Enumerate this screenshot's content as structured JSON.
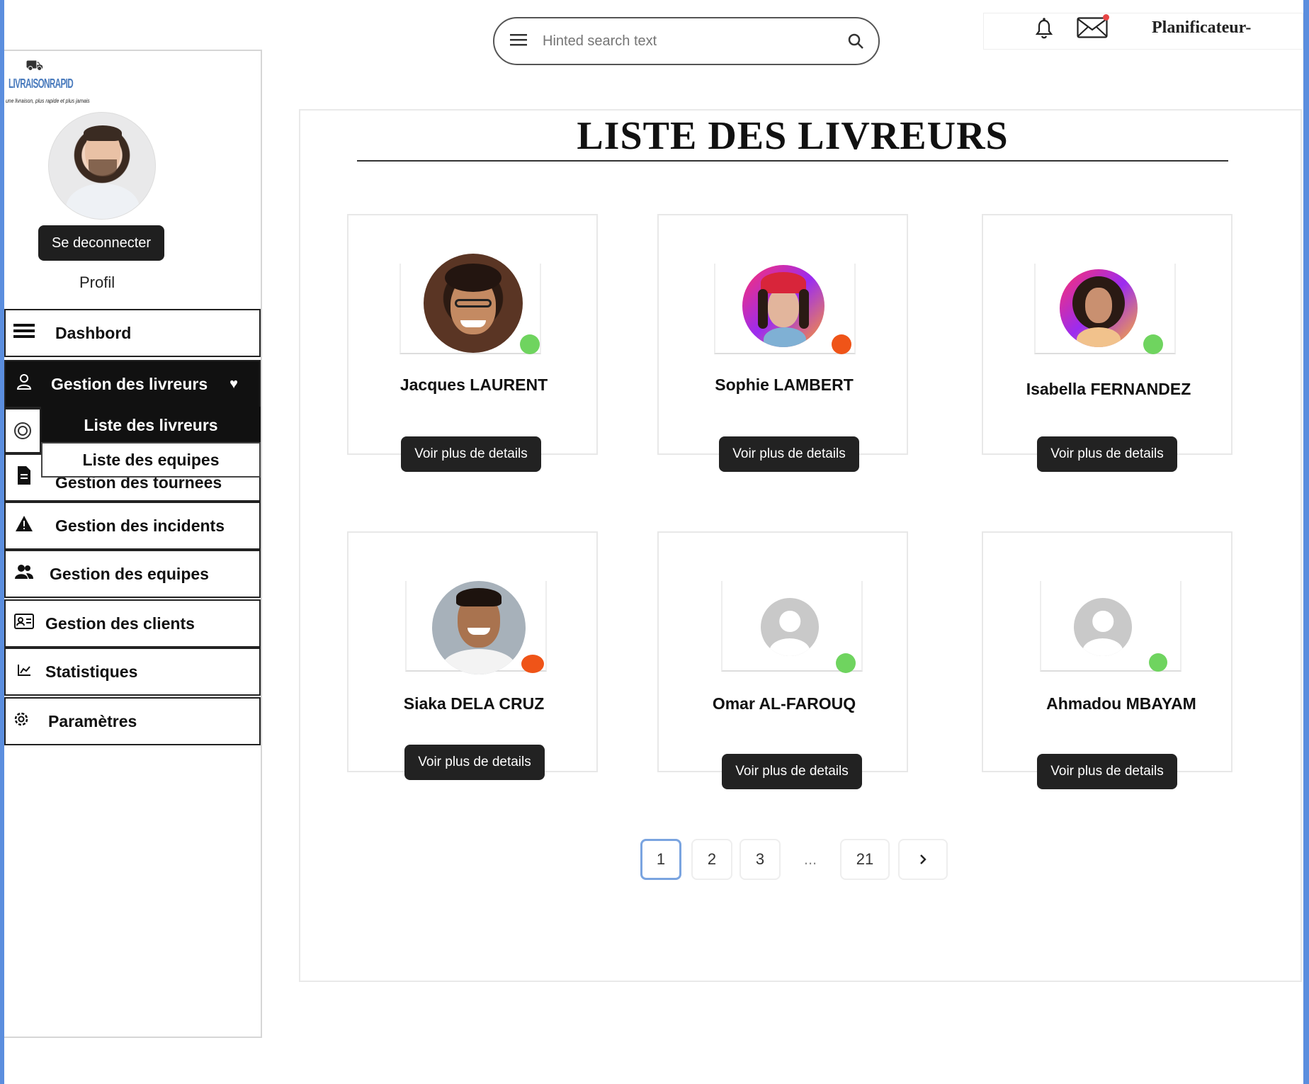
{
  "app": {
    "logo_text": "LIVRAISONRAPID",
    "logo_tagline": "une livraison, plus rapide et plus jamais"
  },
  "sidebar": {
    "logout_label": "Se deconnecter",
    "profile_label": "Profil",
    "items": [
      {
        "label": "Dashbord",
        "icon": "menu-icon"
      },
      {
        "label": "Gestion des livreurs",
        "icon": "user-icon",
        "active": true
      },
      {
        "label": "Gestion des tournees",
        "icon": "document-icon"
      },
      {
        "label": "Gestion des incidents",
        "icon": "warning-icon"
      },
      {
        "label": "Gestion des equipes",
        "icon": "team-icon"
      },
      {
        "label": "Gestion des clients",
        "icon": "id-card-icon"
      },
      {
        "label": "Statistiques",
        "icon": "chart-icon"
      },
      {
        "label": "Paramètres",
        "icon": "gear-icon"
      }
    ],
    "submenu": [
      {
        "label": "Liste des livreurs",
        "active": true
      },
      {
        "label": "Liste des equipes"
      }
    ]
  },
  "header": {
    "search_placeholder": "Hinted search text",
    "user_role": "Planificateur-"
  },
  "main": {
    "title": "LISTE DES  LIVREURS",
    "details_label": "Voir plus de details",
    "couriers": [
      {
        "name": "Jacques LAURENT",
        "status": "online"
      },
      {
        "name": "Sophie LAMBERT",
        "status": "busy"
      },
      {
        "name": "Isabella FERNANDEZ",
        "status": "online"
      },
      {
        "name": "Siaka DELA CRUZ",
        "status": "busy"
      },
      {
        "name": "Omar AL-FAROUQ",
        "status": "online"
      },
      {
        "name": "Ahmadou MBAYAM",
        "status": "online"
      }
    ]
  },
  "pagination": {
    "pages": [
      "1",
      "2",
      "3",
      "...",
      "21"
    ],
    "current": "1",
    "next_icon": "chevron-right-icon"
  },
  "colors": {
    "online": "#6fd45f",
    "busy": "#ef5418",
    "accent_frame": "#5b8ede"
  }
}
